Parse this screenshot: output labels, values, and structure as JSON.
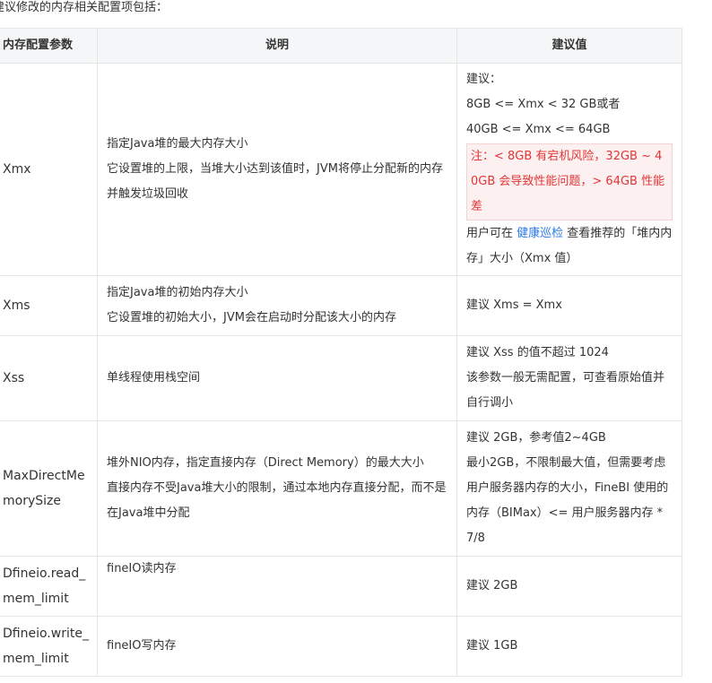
{
  "intro": "建议修改的内存相关配置项包括：",
  "headers": {
    "param": "内存配置参数",
    "desc": "说明",
    "suggest": "建议值"
  },
  "rows": [
    {
      "param": "Xmx",
      "desc": [
        "指定Java堆的最大内存大小",
        "它设置堆的上限，当堆大小达到该值时，JVM将停止分配新的内存并触发垃圾回收"
      ],
      "suggest": {
        "lines": [
          "建议：",
          "8GB <= Xmx < 32 GB或者",
          "40GB <= Xmx <= 64GB"
        ],
        "warning": "注：< 8GB 有宕机风险，32GB ~ 40GB 会导致性能问题，> 64GB 性能差",
        "tail_prefix": "用户可在 ",
        "tail_link": "健康巡检",
        "tail_suffix": " 查看推荐的「堆内内存」大小（Xmx 值）"
      }
    },
    {
      "param": "Xms",
      "desc": [
        "指定Java堆的初始内存大小",
        "它设置堆的初始大小，JVM会在启动时分配该大小的内存"
      ],
      "suggest": [
        "建议 Xms = Xmx"
      ]
    },
    {
      "param": "Xss",
      "desc": [
        "单线程使用栈空间"
      ],
      "suggest": [
        "建议 Xss 的值不超过 1024",
        "该参数一般无需配置，可查看原始值并自行调小"
      ]
    },
    {
      "param": "MaxDirectMemorySize",
      "desc": [
        "堆外NIO内存，指定直接内存（Direct Memory）的最大大小",
        "直接内存不受Java堆大小的限制，通过本地内存直接分配，而不是在Java堆中分配"
      ],
      "suggest": [
        "建议 2GB，参考值2~4GB",
        "最小2GB，不限制最大值，但需要考虑用户服务器内存的大小，FineBI 使用的内存（BIMax）<= 用户服务器内存 * 7/8"
      ]
    },
    {
      "param": "Dfineio.read_mem_limit",
      "desc": [
        "fineIO读内存"
      ],
      "suggest": [
        "建议 2GB"
      ]
    },
    {
      "param": "Dfineio.write_mem_limit",
      "desc": [
        "fineIO写内存"
      ],
      "suggest": [
        "建议 1GB"
      ]
    }
  ],
  "colors": {
    "header_bg": "#f5f6f7",
    "border": "#e6e6e6",
    "warning_text": "#e23636",
    "warning_bg": "#fdf0f0",
    "link": "#2c7be5"
  }
}
